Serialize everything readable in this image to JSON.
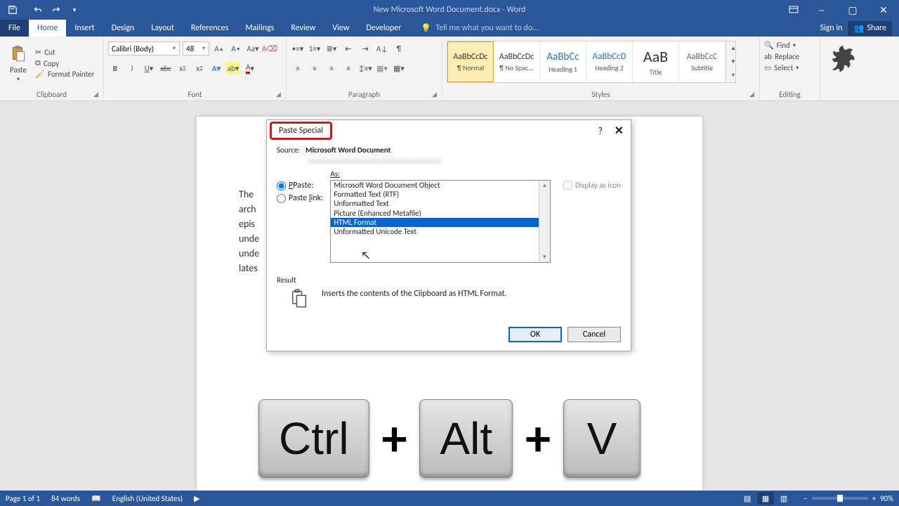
{
  "titlebar": {
    "title": "New Microsoft Word Document.docx - Word"
  },
  "menubar": {
    "file": "File",
    "tabs": [
      "Home",
      "Insert",
      "Design",
      "Layout",
      "References",
      "Mailings",
      "Review",
      "View",
      "Developer"
    ],
    "active_index": 0,
    "tell_me": "Tell me what you want to do...",
    "sign_in": "Sign in",
    "share": "Share"
  },
  "ribbon": {
    "clipboard": {
      "label": "Clipboard",
      "paste": "Paste",
      "cut": "Cut",
      "copy": "Copy",
      "format_painter": "Format Painter"
    },
    "font": {
      "label": "Font",
      "name": "Calibri (Body)",
      "size": "48"
    },
    "paragraph": {
      "label": "Paragraph"
    },
    "styles": {
      "label": "Styles",
      "items": [
        {
          "preview": "AaBbCcDc",
          "label": "¶ Normal",
          "selected": true,
          "size": "12px"
        },
        {
          "preview": "AaBbCcDc",
          "label": "¶ No Spac...",
          "size": "12px"
        },
        {
          "preview": "AaBbCc",
          "label": "Heading 1",
          "size": "15px",
          "color": "#2e74b5"
        },
        {
          "preview": "AaBbCcD",
          "label": "Heading 2",
          "size": "13px",
          "color": "#2e74b5"
        },
        {
          "preview": "AaB",
          "label": "Title",
          "size": "22px"
        },
        {
          "preview": "AaBbCcC",
          "label": "Subtitle",
          "size": "12px",
          "color": "#666"
        }
      ]
    },
    "editing": {
      "label": "Editing",
      "find": "Find",
      "replace": "Replace",
      "select": "Select"
    }
  },
  "document": {
    "lines": [
      "The",
      "arch",
      "epis",
      "unde",
      "unde",
      "lates"
    ]
  },
  "dialog": {
    "title": "Paste Special",
    "source_label": "Source:",
    "source_value": "Microsoft Word Document",
    "paste": "Paste:",
    "paste_link": "Paste link:",
    "as": "As:",
    "items": [
      "Microsoft Word Document Object",
      "Formatted Text (RTF)",
      "Unformatted Text",
      "Picture (Enhanced Metafile)",
      "HTML Format",
      "Unformatted Unicode Text"
    ],
    "selected_index": 4,
    "display_as_icon": "Display as icon",
    "result": "Result",
    "result_desc": "Inserts the contents of the Clipboard as HTML Format.",
    "ok": "OK",
    "cancel": "Cancel"
  },
  "shortcut": {
    "k1": "Ctrl",
    "k2": "Alt",
    "k3": "V",
    "plus": "+"
  },
  "statusbar": {
    "page": "Page 1 of 1",
    "words": "84 words",
    "lang": "English (United States)",
    "zoom": "90%"
  }
}
